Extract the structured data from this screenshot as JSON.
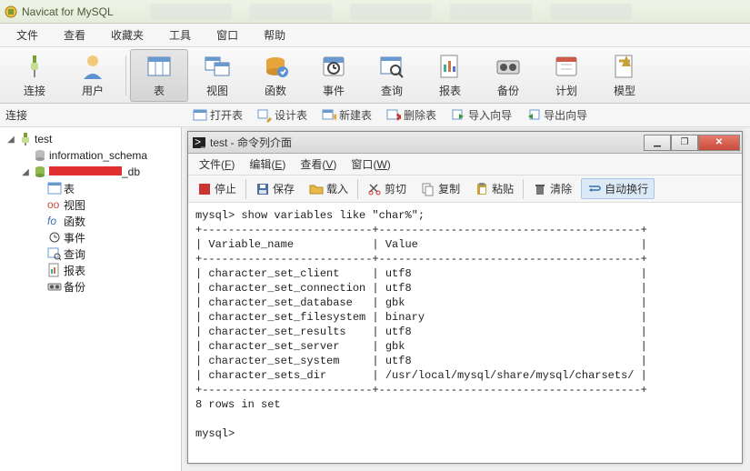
{
  "app": {
    "title": "Navicat for MySQL"
  },
  "menu": {
    "file": "文件",
    "view": "查看",
    "fav": "收藏夹",
    "tools": "工具",
    "window": "窗口",
    "help": "帮助"
  },
  "toolbar": {
    "connect": "连接",
    "user": "用户",
    "table": "表",
    "view": "视图",
    "function": "函数",
    "event": "事件",
    "query": "查询",
    "report": "报表",
    "backup": "备份",
    "schedule": "计划",
    "model": "模型"
  },
  "sub": {
    "conn_label": "连接",
    "open_table": "打开表",
    "design_table": "设计表",
    "new_table": "新建表",
    "delete_table": "删除表",
    "import_wizard": "导入向导",
    "export_wizard": "导出向导"
  },
  "tree": {
    "root": "test",
    "info_schema": "information_schema",
    "db_suffix": "_db",
    "items": [
      "表",
      "视图",
      "函数",
      "事件",
      "查询",
      "报表",
      "备份"
    ]
  },
  "child": {
    "title": "test - 命令列介面",
    "menu": {
      "file": "文件",
      "file_u": "F",
      "edit": "编辑",
      "edit_u": "E",
      "view": "查看",
      "view_u": "V",
      "window": "窗口",
      "window_u": "W"
    },
    "tb": {
      "stop": "停止",
      "save": "保存",
      "load": "载入",
      "cut": "剪切",
      "copy": "复制",
      "paste": "粘贴",
      "clear": "清除",
      "wrap": "自动换行"
    },
    "console": "mysql> show variables like \"char%\";\n+--------------------------+----------------------------------------+\n| Variable_name            | Value                                  |\n+--------------------------+----------------------------------------+\n| character_set_client     | utf8                                   |\n| character_set_connection | utf8                                   |\n| character_set_database   | gbk                                    |\n| character_set_filesystem | binary                                 |\n| character_set_results    | utf8                                   |\n| character_set_server     | gbk                                    |\n| character_set_system     | utf8                                   |\n| character_sets_dir       | /usr/local/mysql/share/mysql/charsets/ |\n+--------------------------+----------------------------------------+\n8 rows in set\n\nmysql>"
  }
}
